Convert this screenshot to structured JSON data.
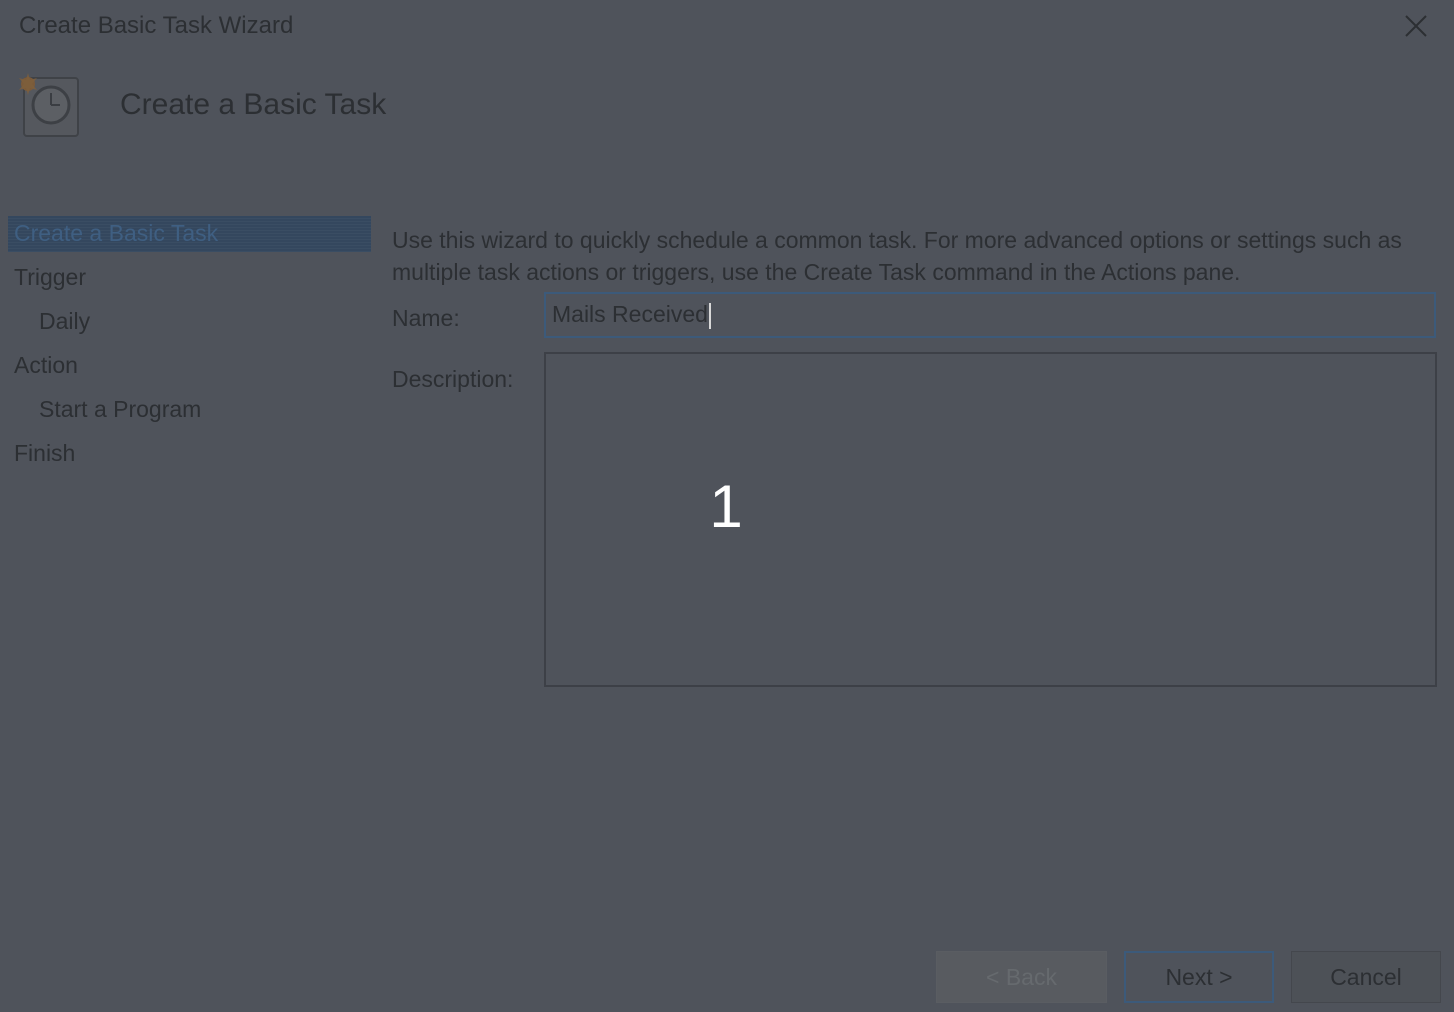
{
  "window": {
    "title": "Create Basic Task Wizard"
  },
  "header": {
    "title": "Create a Basic Task",
    "icon": "task-scheduler-clock-icon"
  },
  "steps": [
    {
      "label": "Create a Basic Task",
      "active": true
    },
    {
      "label": "Trigger"
    },
    {
      "label": "Daily"
    },
    {
      "label": "Action"
    },
    {
      "label": "Start a Program"
    },
    {
      "label": "Finish"
    }
  ],
  "main": {
    "intro": "Use this wizard to quickly schedule a common task.  For more advanced options or settings such as multiple task actions or triggers, use the Create Task command in the Actions pane.",
    "name_label": "Name:",
    "name_value": "Mails Received",
    "description_label": "Description:",
    "description_value": ""
  },
  "overlay": {
    "number": "1"
  },
  "buttons": {
    "back": "< Back",
    "next": "Next >",
    "cancel": "Cancel"
  }
}
